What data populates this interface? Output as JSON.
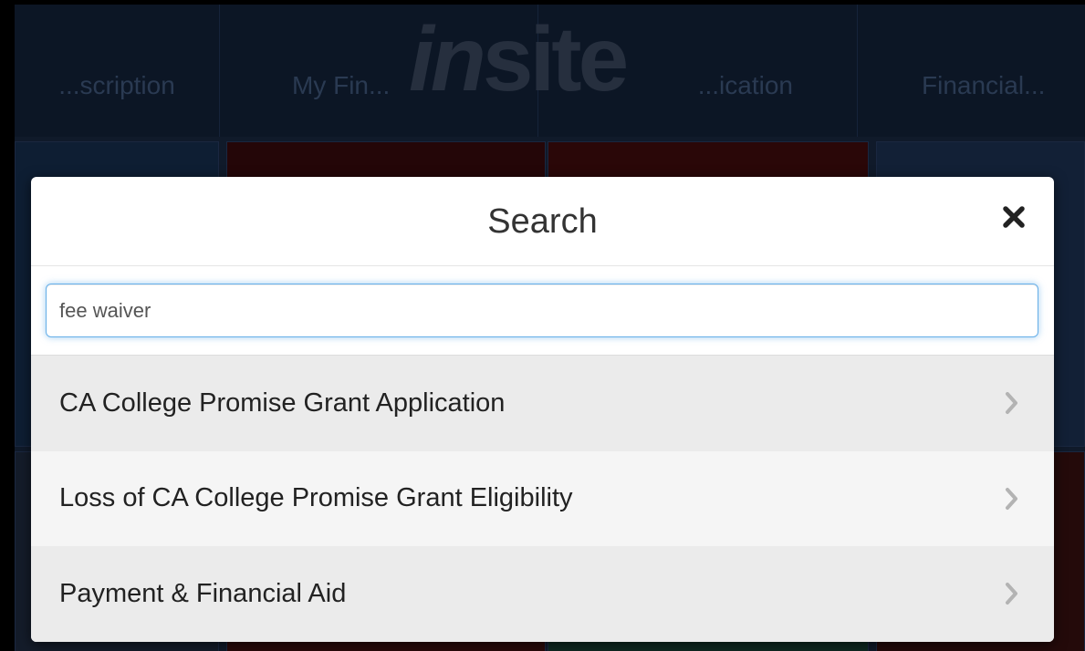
{
  "background": {
    "logo": {
      "prefix": "in",
      "suffix": "site"
    },
    "nav_items": [
      "...scription",
      "My Fin...",
      "...ication",
      "Financial..."
    ]
  },
  "modal": {
    "title": "Search",
    "close_icon": "close-icon",
    "search": {
      "value": "fee waiver",
      "placeholder": ""
    },
    "results": [
      {
        "label": "CA College Promise Grant Application",
        "icon": "chevron-right-icon"
      },
      {
        "label": "Loss of CA College Promise Grant Eligibility",
        "icon": "chevron-right-icon"
      },
      {
        "label": "Payment & Financial Aid",
        "icon": "chevron-right-icon"
      }
    ]
  },
  "colors": {
    "focus_border": "#66afe9",
    "row_odd": "#ebebeb",
    "row_even": "#f5f5f5",
    "backdrop": "#101a2a"
  }
}
